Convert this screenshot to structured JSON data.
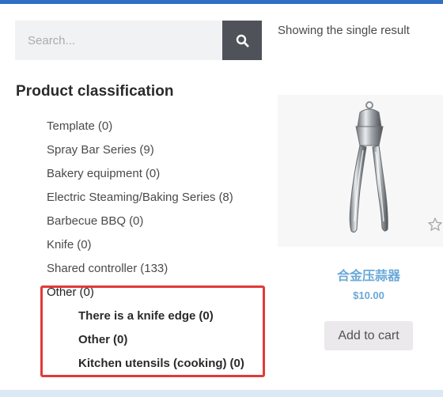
{
  "search": {
    "placeholder": "Search..."
  },
  "sidebar": {
    "heading": "Product classification",
    "categories": [
      {
        "label": "Template",
        "count": "(0)"
      },
      {
        "label": "Spray Bar Series",
        "count": "(9)"
      },
      {
        "label": "Bakery equipment",
        "count": "(0)"
      },
      {
        "label": "Electric Steaming/Baking Series",
        "count": "(8)"
      },
      {
        "label": "Barbecue BBQ",
        "count": "(0)"
      },
      {
        "label": "Knife",
        "count": "(0)"
      },
      {
        "label": "Shared controller",
        "count": "(133)"
      },
      {
        "label": "Other",
        "count": "(0)"
      }
    ],
    "subcategories": [
      {
        "label": "There is a knife edge",
        "count": "(0)"
      },
      {
        "label": "Other",
        "count": "(0)"
      },
      {
        "label": "Kitchen utensils (cooking)",
        "count": "(0)"
      }
    ]
  },
  "results": {
    "count_text": "Showing the single result"
  },
  "product": {
    "title": "合金压蒜器",
    "price": "$10.00",
    "add_to_cart_label": "Add to cart",
    "image_icon": "garlic-press-image",
    "rating_icon": "star-outline-icon"
  },
  "colors": {
    "accent_top": "#2f6fc4",
    "search_button": "#4f5359",
    "link_blue": "#6aa8d9",
    "highlight_red": "#e23a3a"
  }
}
